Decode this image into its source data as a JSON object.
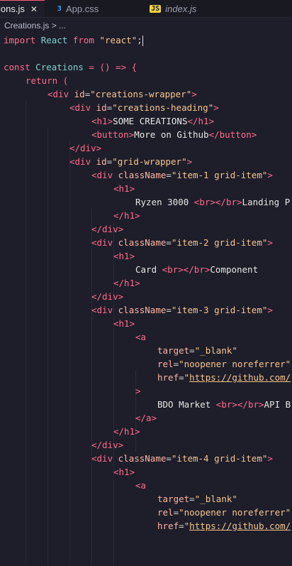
{
  "tabs": [
    {
      "label": "ions.js",
      "icon": "",
      "active": true
    },
    {
      "label": "App.css",
      "icon": "3",
      "active": false
    },
    {
      "label": "index.js",
      "icon": "JS",
      "active": false
    }
  ],
  "breadcrumb": "Creations.js > ...",
  "code": {
    "l1_import": "import",
    "l1_react": "React",
    "l1_from": "from",
    "l1_str": "\"react\"",
    "l1_semi": ";",
    "l3_const": "const",
    "l3_name": "Creations",
    "l3_rest": " = () => {",
    "l4_return": "return",
    "l4_paren": " (",
    "l5_open": "<div",
    "l5_attr": "id",
    "l5_val": "\"creations-wrapper\"",
    "l6_open": "<div",
    "l6_attr": "id",
    "l6_val": "\"creations-heading\"",
    "l7_h1": "<h1>",
    "l7_text": "SOME CREATIONS",
    "l7_close": "</h1>",
    "l8_btn": "<button>",
    "l8_text": "More on Github",
    "l8_close": "</button>",
    "l9_close": "</div>",
    "l10_open": "<div",
    "l10_attr": "id",
    "l10_val": "\"grid-wrapper\"",
    "l11_open": "<div",
    "l11_attr": "className",
    "l11_val": "\"item-1 grid-item\"",
    "l12_h1": "<h1>",
    "l13_text": "Ryzen 3000 ",
    "l13_br": "<br></br>",
    "l13_text2": "Landing P",
    "l14_close": "</h1>",
    "l15_close": "</div>",
    "l16_open": "<div",
    "l16_attr": "className",
    "l16_val": "\"item-2 grid-item\"",
    "l17_h1": "<h1>",
    "l18_text": "Card ",
    "l18_br": "<br></br>",
    "l18_text2": "Component",
    "l19_close": "</h1>",
    "l20_close": "</div>",
    "l21_open": "<div",
    "l21_attr": "className",
    "l21_val": "\"item-3 grid-item\"",
    "l22_h1": "<h1>",
    "l23_a": "<a",
    "l24_attr": "target",
    "l24_val": "\"_blank\"",
    "l25_attr": "rel",
    "l25_val": "\"noopener noreferrer\"",
    "l26_attr": "href",
    "l26_q": "\"",
    "l26_url": "https://github.com/",
    "l27_gt": ">",
    "l28_text": "BDO Market ",
    "l28_br": "<br></br>",
    "l28_text2": "API B",
    "l29_close": "</a>",
    "l30_close": "</h1>",
    "l31_close": "</div>",
    "l32_open": "<div",
    "l32_attr": "className",
    "l32_val": "\"item-4 grid-item\"",
    "l33_h1": "<h1>",
    "l34_a": "<a",
    "l35_attr": "target",
    "l35_val": "\"_blank\"",
    "l36_attr": "rel",
    "l36_val": "\"noopener noreferrer\"",
    "l37_attr": "href",
    "l37_q": "\"",
    "l37_url": "https://github.com/"
  }
}
